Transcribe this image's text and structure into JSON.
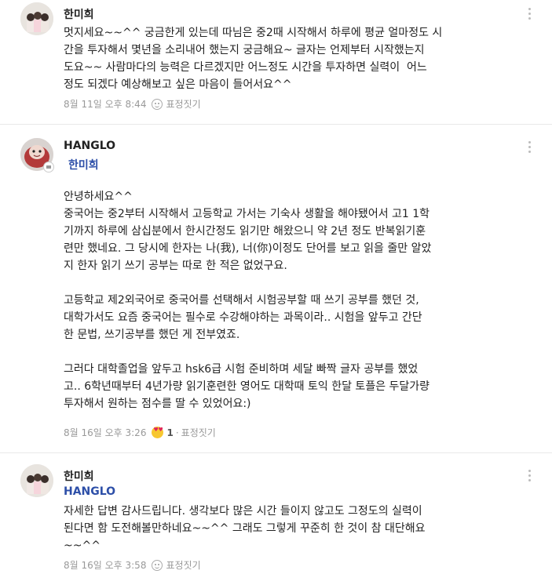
{
  "comments": [
    {
      "author": "한미희",
      "body": "멋지세요~~^^ 궁금한게 있는데 따님은 중2때 시작해서 하루에 평균 얼마정도 시\n간을 투자해서 몇년을 소리내어 했는지 궁금해요~ 글자는 언제부터 시작했는지\n도요~~ 사람마다의 능력은 다르겠지만 어느정도 시간을 투자하면 실력이  어느\n정도 되겠다 예상해보고 싶은 마음이 들어서요^^",
      "date": "8월 11일 오후 8:44",
      "reaction_label": "표정짓기"
    },
    {
      "author": "HANGLO",
      "mention": "한미희",
      "body": "안녕하세요^^\n중국어는 중2부터 시작해서 고등학교 가서는 기숙사 생활을 해야됐어서 고1 1학\n기까지 하루에 삼십분에서 한시간정도 읽기만 해왔으니 약 2년 정도 반복읽기훈\n련만 했네요. 그 당시에 한자는 나(我), 너(你)이정도 단어를 보고 읽을 줄만 알았\n지 한자 읽기 쓰기 공부는 따로 한 적은 없었구요.\n\n고등학교 제2외국어로 중국어를 선택해서 시험공부할 때 쓰기 공부를 했던 것,\n대학가서도 요즘 중국어는 필수로 수강해야하는 과목이라.. 시험을 앞두고 간단\n한 문법, 쓰기공부를 했던 게 전부였죠.\n\n그러다 대학졸업을 앞두고 hsk6급 시험 준비하며 세달 빠짝 글자 공부를 했었\n고.. 6학년때부터 4년가량 읽기훈련한 영어도 대학때 토익 한달 토플은 두달가량\n투자해서 원하는 점수를 딸 수 있었어요:)",
      "date": "8월 16일 오후 3:26",
      "reaction_count": "1",
      "reaction_label": "표정짓기"
    },
    {
      "author": "한미희",
      "mention": "HANGLO",
      "body": "자세한 답변 감사드립니다. 생각보다 많은 시간 들이지 않고도 그정도의 실력이\n된다면 함 도전해볼만하네요~~^^ 그래도 그렇게 꾸준히 한 것이 참 대단해요\n~~^^",
      "date": "8월 16일 오후 3:58",
      "reaction_label": "표정짓기"
    }
  ]
}
